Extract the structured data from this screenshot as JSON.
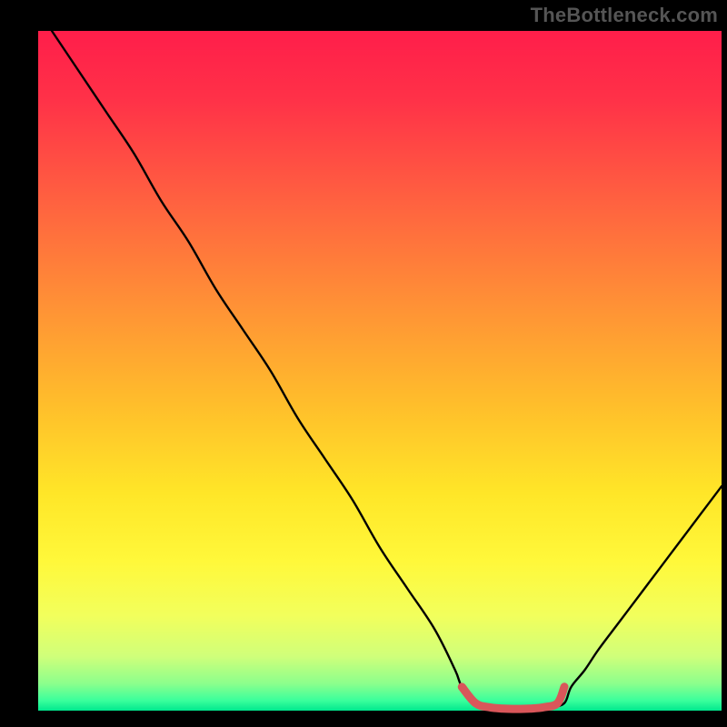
{
  "watermark": {
    "text": "TheBottleneck.com"
  },
  "plot": {
    "margin_left": 42,
    "margin_right": 6,
    "margin_top": 34,
    "margin_bottom": 18,
    "inner_width": 752,
    "inner_height": 748
  },
  "gradient_stops": [
    {
      "offset": 0.0,
      "color": "#ff1e4a"
    },
    {
      "offset": 0.1,
      "color": "#ff3148"
    },
    {
      "offset": 0.25,
      "color": "#ff6140"
    },
    {
      "offset": 0.4,
      "color": "#ff9036"
    },
    {
      "offset": 0.55,
      "color": "#ffbe2b"
    },
    {
      "offset": 0.68,
      "color": "#ffe628"
    },
    {
      "offset": 0.78,
      "color": "#fff83a"
    },
    {
      "offset": 0.86,
      "color": "#f2ff5c"
    },
    {
      "offset": 0.92,
      "color": "#d0ff7a"
    },
    {
      "offset": 0.96,
      "color": "#8cff8c"
    },
    {
      "offset": 0.985,
      "color": "#3bff9c"
    },
    {
      "offset": 1.0,
      "color": "#00e88e"
    }
  ],
  "chart_data": {
    "type": "line",
    "title": "",
    "xlabel": "",
    "ylabel": "",
    "xlim": [
      0,
      100
    ],
    "ylim": [
      0,
      100
    ],
    "grid": false,
    "legend": false,
    "notes": "Heat gradient background runs vertically from red (high bottleneck %) at top to green (low) at bottom. Black curve shows bottleneck % vs relative component performance; red segment highlights the optimal flat region near the minimum.",
    "series": [
      {
        "name": "bottleneck_curve_black",
        "color": "#000000",
        "x": [
          2,
          6,
          10,
          14,
          18,
          22,
          26,
          30,
          34,
          38,
          42,
          46,
          50,
          54,
          58,
          61,
          62,
          64,
          66,
          68,
          73,
          75,
          77,
          78,
          80,
          82,
          85,
          88,
          91,
          94,
          97,
          100
        ],
        "y": [
          100,
          94,
          88,
          82,
          75,
          69,
          62,
          56,
          50,
          43,
          37,
          31,
          24,
          18,
          12,
          6,
          3.5,
          1.1,
          0.5,
          0.3,
          0.3,
          0.5,
          1.1,
          3.5,
          6,
          9,
          13,
          17,
          21,
          25,
          29,
          33
        ]
      },
      {
        "name": "bottleneck_optimum_red",
        "color": "#d9565a",
        "stroke_width": 9,
        "x": [
          62,
          64,
          66,
          68,
          70,
          72,
          74,
          76,
          77
        ],
        "y": [
          3.5,
          1.1,
          0.5,
          0.3,
          0.25,
          0.3,
          0.5,
          1.1,
          3.5
        ]
      }
    ]
  }
}
